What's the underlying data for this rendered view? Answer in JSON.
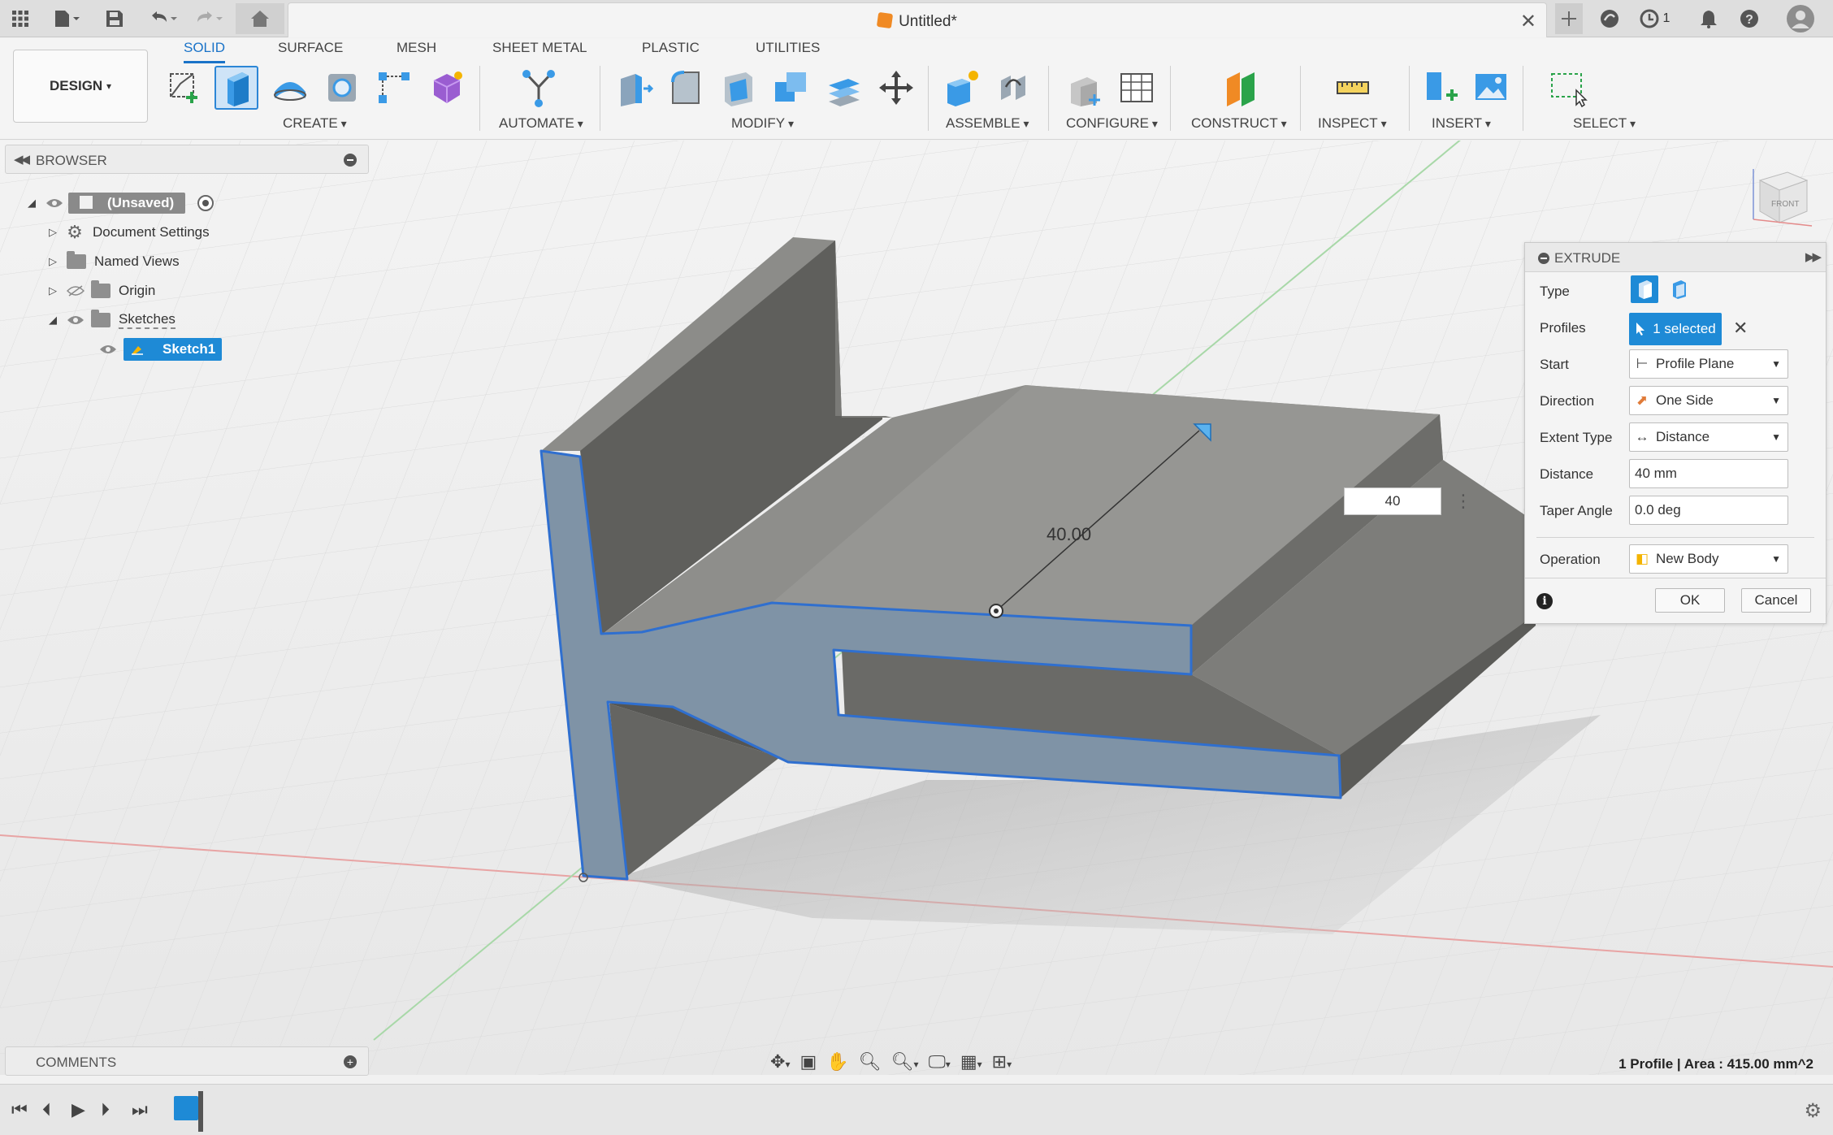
{
  "app": {
    "document_title": "Untitled*",
    "notifications_count": "1"
  },
  "ribbon": {
    "design_button": "DESIGN",
    "tabs": [
      {
        "label": "SOLID",
        "active": true
      },
      {
        "label": "SURFACE"
      },
      {
        "label": "MESH"
      },
      {
        "label": "SHEET METAL"
      },
      {
        "label": "PLASTIC"
      },
      {
        "label": "UTILITIES"
      }
    ],
    "groups": {
      "create": "CREATE",
      "automate": "AUTOMATE",
      "modify": "MODIFY",
      "assemble": "ASSEMBLE",
      "configure": "CONFIGURE",
      "construct": "CONSTRUCT",
      "inspect": "INSPECT",
      "insert": "INSERT",
      "select": "SELECT"
    }
  },
  "browser": {
    "title": "BROWSER",
    "items": [
      {
        "label": "(Unsaved)"
      },
      {
        "label": "Document Settings"
      },
      {
        "label": "Named Views"
      },
      {
        "label": "Origin"
      },
      {
        "label": "Sketches"
      },
      {
        "label": "Sketch1"
      }
    ]
  },
  "extrude": {
    "title": "EXTRUDE",
    "fields": {
      "type_label": "Type",
      "profiles_label": "Profiles",
      "profiles_value": "1 selected",
      "start_label": "Start",
      "start_value": "Profile Plane",
      "direction_label": "Direction",
      "direction_value": "One Side",
      "extent_label": "Extent Type",
      "extent_value": "Distance",
      "distance_label": "Distance",
      "distance_value": "40 mm",
      "taper_label": "Taper Angle",
      "taper_value": "0.0 deg",
      "operation_label": "Operation",
      "operation_value": "New Body"
    },
    "ok": "OK",
    "cancel": "Cancel"
  },
  "canvas": {
    "dimension_input": "40",
    "dimension_label": "40.00",
    "viewcube_label": "FRONT"
  },
  "comments": {
    "title": "COMMENTS"
  },
  "status": {
    "text": "1 Profile | Area : 415.00 mm^2"
  },
  "colors": {
    "accent": "#1e8ad6",
    "profile_face": "#7f93a6",
    "body_top": "#8e8e8b",
    "body_side": "#6f6f6c"
  }
}
